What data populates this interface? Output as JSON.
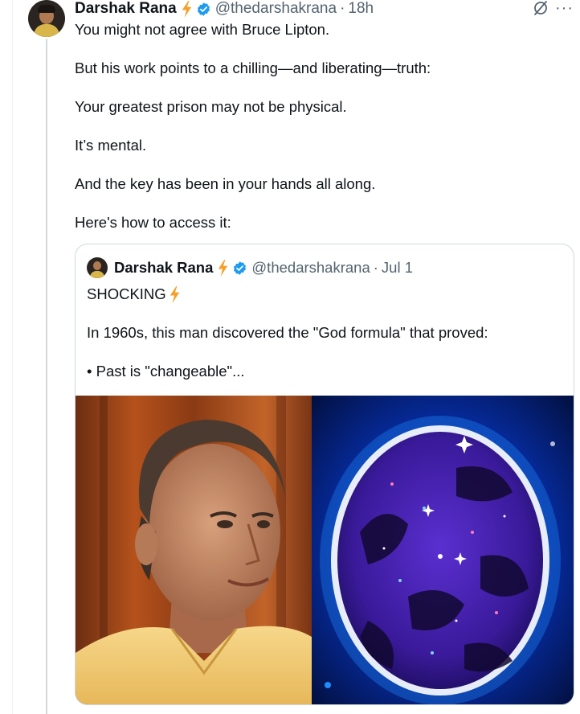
{
  "tweet": {
    "author": "Darshak Rana",
    "handle": "@thedarshakrana",
    "separator": "·",
    "time": "18h",
    "lines": [
      "You might not agree with Bruce Lipton.",
      "But his work points to a chilling—and liberating—truth:",
      "Your greatest prison may not be physical.",
      "It’s mental.",
      "And the key has been in your hands all along.",
      "Here's how to access it:"
    ]
  },
  "quoted": {
    "author": "Darshak Rana",
    "handle": "@thedarshakrana",
    "separator": "·",
    "time": "Jul 1",
    "headline": "SHOCKING",
    "lines": [
      "In 1960s, this man discovered the \"God formula\" that proved:",
      "• Past is \"changeable\"..."
    ]
  },
  "icons": {
    "lightning": "lightning-bolt-icon",
    "verified": "verified-badge-icon",
    "grok": "grok-icon",
    "more": "more-options-icon"
  },
  "colors": {
    "verified_blue": "#1d9bf0",
    "bolt_orange": "#f4a02a",
    "secondary_text": "#536471"
  },
  "more_glyph": "···"
}
